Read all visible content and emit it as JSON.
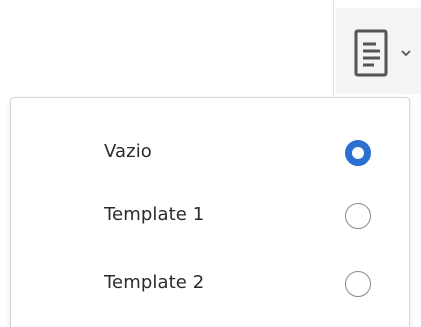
{
  "toolbar": {
    "template_button_icon": "document-lines-icon",
    "template_button_caret": "chevron-down-icon"
  },
  "template_menu": {
    "options": [
      {
        "label": "Vazio",
        "selected": true
      },
      {
        "label": "Template 1",
        "selected": false
      },
      {
        "label": "Template 2",
        "selected": false
      }
    ]
  },
  "colors": {
    "accent": "#2b6fd1",
    "text": "#2b2b2b",
    "radio_border": "#8a8a8a",
    "button_bg": "#f4f4f4",
    "panel_border": "#d8d8d8"
  }
}
